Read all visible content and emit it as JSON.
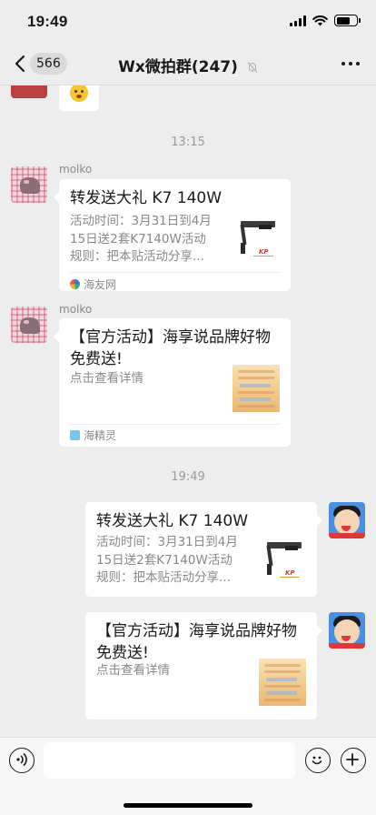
{
  "status_bar": {
    "time": "19:49"
  },
  "nav": {
    "back_count": "566",
    "title": "Wx微拍群(247)"
  },
  "chat": {
    "timestamps": [
      "13:15",
      "19:49"
    ],
    "messages": [
      {
        "sender": "molko",
        "title": "转发送大礼 K7 140W",
        "desc_lines": [
          "活动时间：3月31日到4月",
          "15日送2套K7140W活动",
          "规则：把本贴活动分享..."
        ],
        "source": "海友网",
        "thumb_text": "KP"
      },
      {
        "sender": "molko",
        "title_lines": [
          "【官方活动】海享说品牌好物",
          "免费送!"
        ],
        "desc": "点击查看详情",
        "source": "海精灵"
      },
      {
        "title": "转发送大礼 K7 140W",
        "desc_lines": [
          "活动时间：3月31日到4月",
          "15日送2套K7140W活动",
          "规则：把本贴活动分享..."
        ],
        "thumb_text": "KP"
      },
      {
        "title_lines": [
          "【官方活动】海享说品牌好物",
          "免费送!"
        ],
        "desc": "点击查看详情"
      }
    ]
  },
  "input": {
    "value": ""
  },
  "icons": {
    "back": "chevron-left-icon",
    "mute": "bell-slash-icon",
    "more": "more-icon",
    "voice": "voice-icon",
    "emoji": "emoji-icon",
    "plus": "plus-icon"
  },
  "colors": {
    "background": "#ededed",
    "bubble": "#ffffff",
    "meta_text": "#888888"
  }
}
